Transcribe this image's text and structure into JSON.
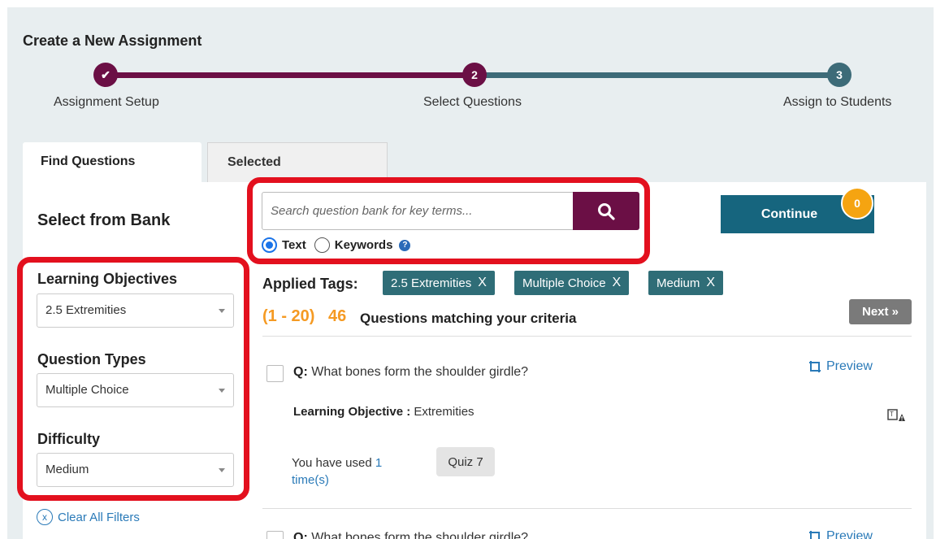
{
  "header": {
    "title": "Create a New Assignment"
  },
  "stepper": {
    "steps": [
      {
        "label": "Assignment Setup",
        "state": "done",
        "marker": "✔"
      },
      {
        "label": "Select Questions",
        "state": "current",
        "marker": "2"
      },
      {
        "label": "Assign to Students",
        "state": "todo",
        "marker": "3"
      }
    ]
  },
  "tabs": [
    {
      "label": "Find Questions",
      "active": true
    },
    {
      "label": "Selected",
      "active": false
    }
  ],
  "sidebar": {
    "title": "Select from Bank",
    "filters": [
      {
        "label": "Learning Objectives",
        "value": "2.5 Extremities"
      },
      {
        "label": "Question Types",
        "value": "Multiple Choice"
      },
      {
        "label": "Difficulty",
        "value": "Medium"
      }
    ],
    "clear_label": "Clear All Filters",
    "clear_icon": "x"
  },
  "search": {
    "placeholder": "Search question bank for key terms...",
    "options": [
      {
        "label": "Text",
        "selected": true
      },
      {
        "label": "Keywords",
        "selected": false
      }
    ],
    "help_icon": "?"
  },
  "continue": {
    "label": "Continue",
    "badge": "0"
  },
  "tags": {
    "label": "Applied Tags:",
    "items": [
      "2.5 Extremities",
      "Multiple Choice",
      "Medium"
    ],
    "remove_glyph": "X"
  },
  "results": {
    "range": "(1 - 20)",
    "total": "46",
    "caption": "Questions matching your criteria",
    "next_label": "Next »",
    "questions": [
      {
        "prefix": "Q:",
        "text": "What bones form the shoulder girdle?",
        "preview_label": "Preview",
        "lo_label": "Learning Objective :",
        "lo_value": "Extremities",
        "used_prefix": "You have used",
        "used_count": "1",
        "used_suffix": "time(s)",
        "quiz": "Quiz 7"
      },
      {
        "prefix": "Q:",
        "text": "What bones form the shoulder girdle?",
        "preview_label": "Preview"
      }
    ]
  },
  "colors": {
    "brand": "#6b0f45",
    "teal": "#16657e",
    "tag": "#2f6d77",
    "accent": "#f59a23",
    "highlight": "#e3101e",
    "link": "#2a7ab8"
  }
}
